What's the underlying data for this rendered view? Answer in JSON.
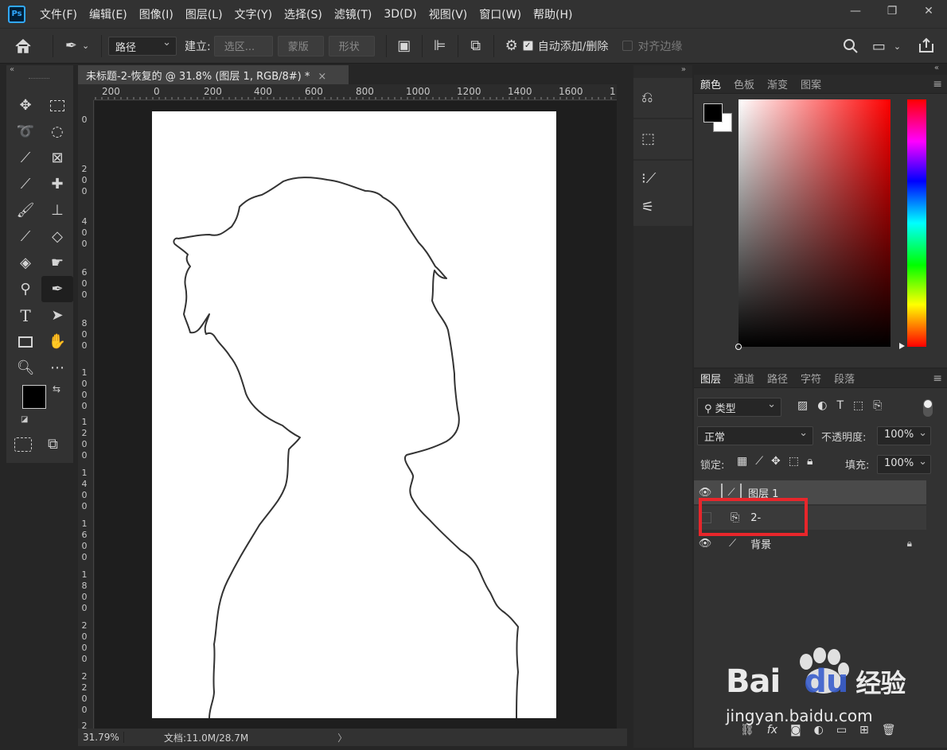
{
  "app": {
    "logo": "Ps"
  },
  "menu": [
    "文件(F)",
    "编辑(E)",
    "图像(I)",
    "图层(L)",
    "文字(Y)",
    "选择(S)",
    "滤镜(T)",
    "3D(D)",
    "视图(V)",
    "窗口(W)",
    "帮助(H)"
  ],
  "window": {
    "minimize": "—",
    "restore": "❐",
    "close": "✕"
  },
  "options": {
    "mode": "路径",
    "make_label": "建立:",
    "selection_btn": "选区...",
    "mask_btn": "蒙版",
    "shape_btn": "形状",
    "auto_add_label": "自动添加/删除",
    "align_edges_label": "对齐边缘"
  },
  "document": {
    "tab_title": "未标题-2-恢复的 @ 31.8% (图层 1, RGB/8#) *",
    "close": "×"
  },
  "ruler": {
    "h_ticks": [
      "200",
      "0",
      "200",
      "400",
      "600",
      "800",
      "1000",
      "1200",
      "1400",
      "1600",
      "1"
    ],
    "v_ticks": [
      "0",
      "200",
      "400",
      "600",
      "800",
      "1000",
      "1200",
      "1400",
      "1600",
      "1800",
      "2000",
      "2200",
      "2"
    ]
  },
  "status": {
    "zoom": "31.79%",
    "doc_info": "文档:11.0M/28.7M",
    "arrow": "〉"
  },
  "color_panel": {
    "tabs": [
      "颜色",
      "色板",
      "渐变",
      "图案"
    ],
    "foreground": "#000000",
    "background": "#ffffff"
  },
  "layers_panel": {
    "tabs": [
      "图层",
      "通道",
      "路径",
      "字符",
      "段落"
    ],
    "filter_kind": "类型",
    "blend_mode": "正常",
    "opacity_label": "不透明度:",
    "opacity": "100%",
    "lock_label": "锁定:",
    "fill_label": "填充:",
    "fill": "100%",
    "layers": [
      {
        "name": "图层 1",
        "visible": true,
        "selected": true
      },
      {
        "name": "2-",
        "visible": false,
        "selected": false
      },
      {
        "name": "背景",
        "visible": true,
        "selected": false
      }
    ]
  },
  "annotation": {
    "highlight_color": "#e8262b"
  },
  "watermark": {
    "brand": "Bai",
    "brand2": "du",
    "suffix": "经验",
    "url": "jingyan.baidu.com"
  }
}
